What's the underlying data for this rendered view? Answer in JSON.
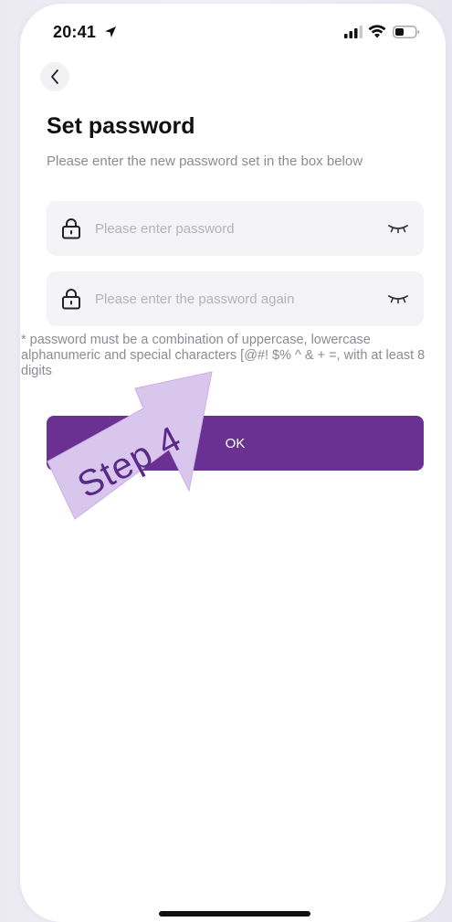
{
  "status_bar": {
    "time": "20:41",
    "location_icon": "location-arrow-icon",
    "signal_icon": "cellular-signal-icon",
    "wifi_icon": "wifi-icon",
    "battery_icon": "battery-icon"
  },
  "nav": {
    "back_icon": "chevron-left-icon"
  },
  "page": {
    "title": "Set password",
    "subtitle": "Please enter the new password set in the box below"
  },
  "form": {
    "password": {
      "placeholder": "Please enter password",
      "value": "",
      "lead_icon": "lock-icon",
      "trail_icon": "eye-closed-icon"
    },
    "password_confirm": {
      "placeholder": "Please enter the password again",
      "value": "",
      "lead_icon": "lock-icon",
      "trail_icon": "eye-closed-icon"
    },
    "hint": "* password must be a combination of uppercase, lowercase alphanumeric and special characters [@#! $% ^ & + =, with at least 8 digits",
    "submit_label": "OK"
  },
  "annotation": {
    "step_label": "Step 4"
  },
  "colors": {
    "accent": "#6a3192",
    "field_background": "#f4f4f6",
    "annotation_arrow": "#d9c6ec",
    "annotation_text": "#5a2a88"
  }
}
